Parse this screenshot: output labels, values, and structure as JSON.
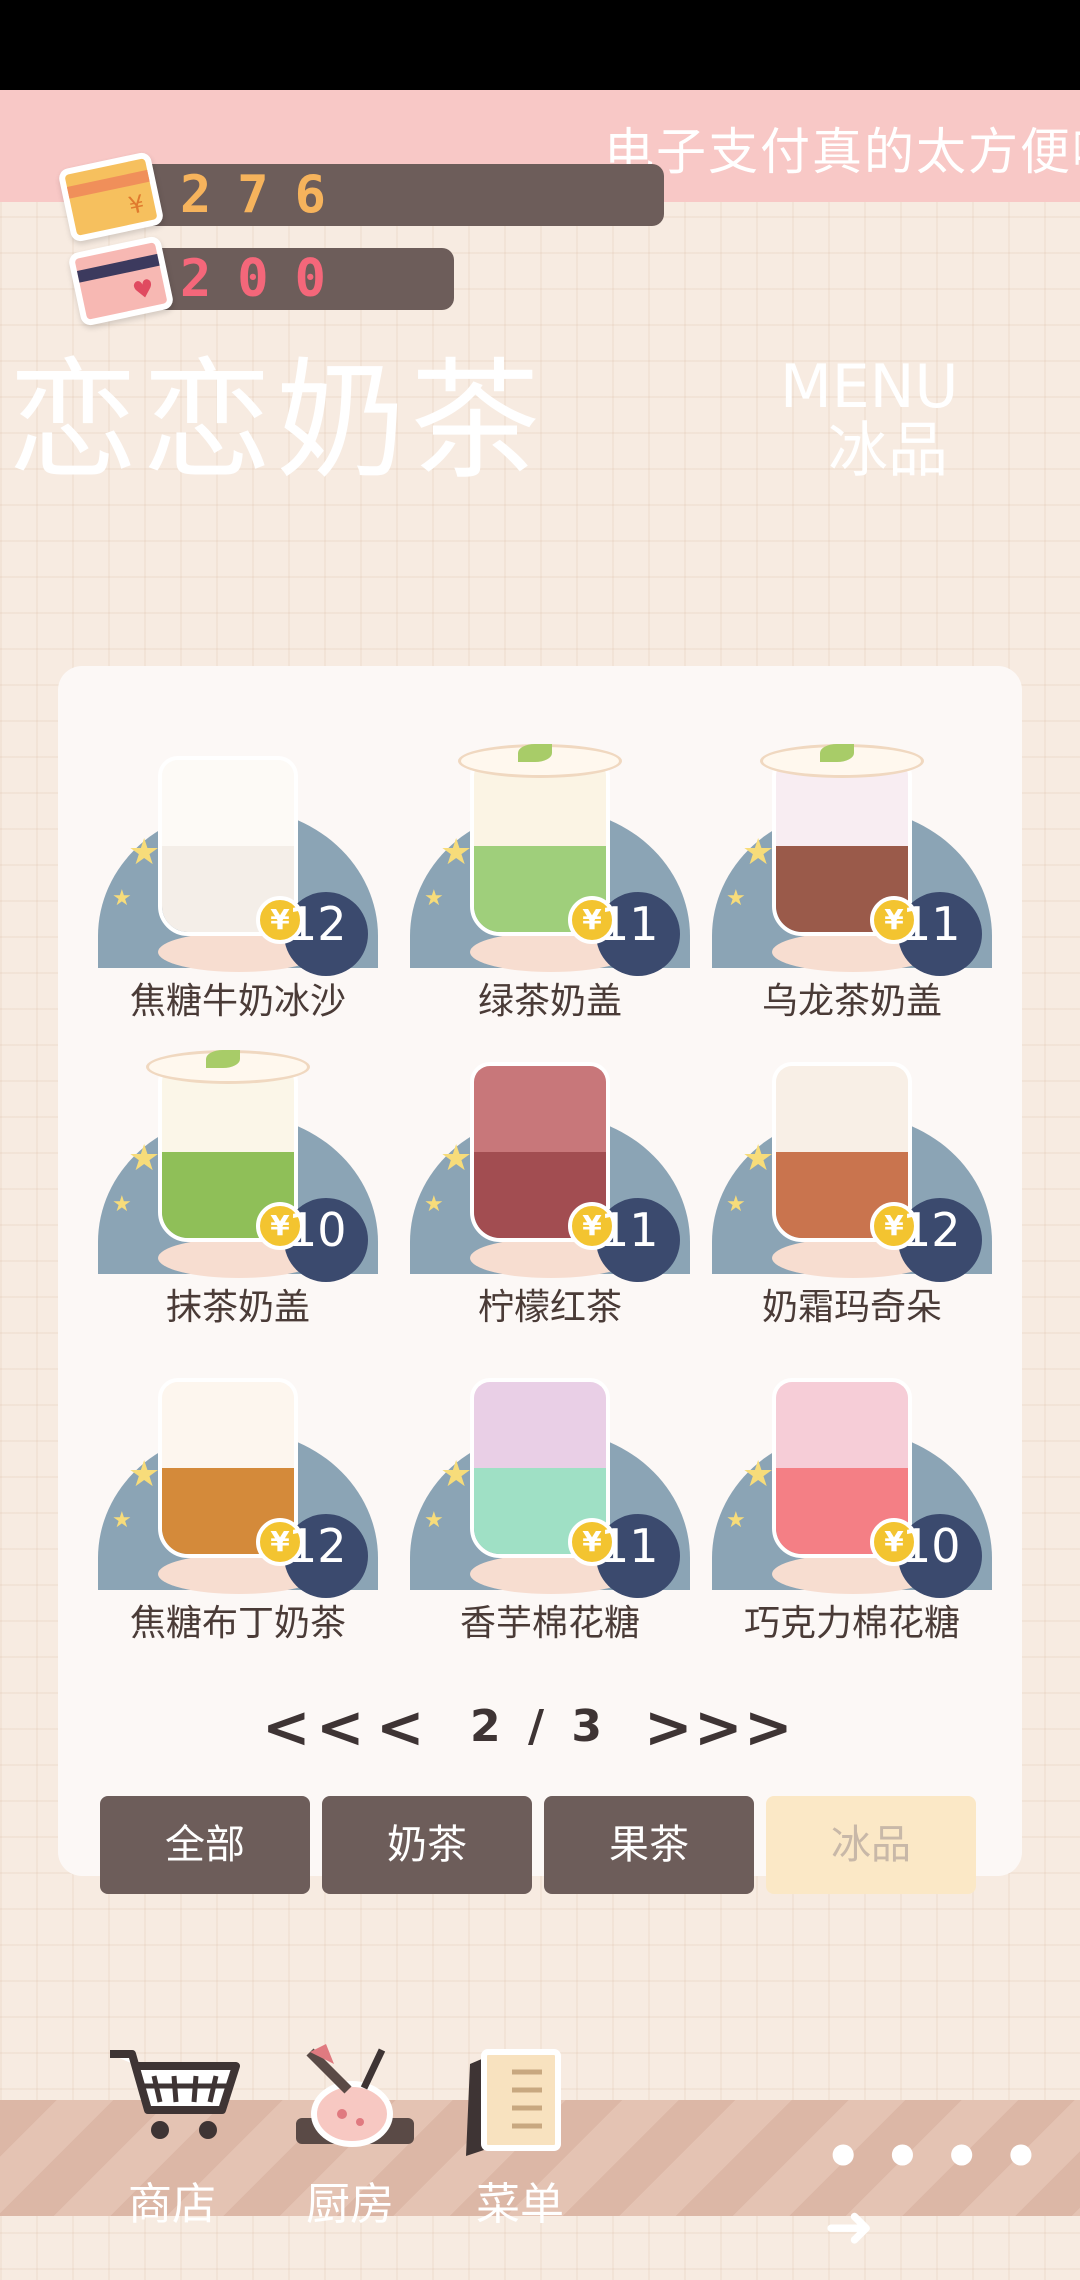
{
  "marquee": {
    "text": "电子支付真的太方便啦"
  },
  "wallet": {
    "money": "276",
    "hearts": "200"
  },
  "shop": {
    "title": "恋恋奶茶",
    "menu_label": "MENU",
    "category": "冰品"
  },
  "items": [
    {
      "name": "焦糖牛奶冰沙",
      "price": "12",
      "top": "#fdfaf6",
      "bottom": "#f4eee8",
      "lid": false
    },
    {
      "name": "绿茶奶盖",
      "price": "11",
      "top": "#fbf4e4",
      "bottom": "#9fcf7b",
      "lid": true
    },
    {
      "name": "乌龙茶奶盖",
      "price": "11",
      "top": "#f8edf2",
      "bottom": "#9a5a4a",
      "lid": true
    },
    {
      "name": "抹茶奶盖",
      "price": "10",
      "top": "#fbf6e8",
      "bottom": "#8fbf58",
      "lid": true
    },
    {
      "name": "柠檬红茶",
      "price": "11",
      "top": "#c8777a",
      "bottom": "#a24d51",
      "lid": false
    },
    {
      "name": "奶霜玛奇朵",
      "price": "12",
      "top": "#f8efe6",
      "bottom": "#c9744e",
      "lid": false
    },
    {
      "name": "焦糖布丁奶茶",
      "price": "12",
      "top": "#fdf6ee",
      "bottom": "#d48a3a",
      "lid": false
    },
    {
      "name": "香芋棉花糖",
      "price": "11",
      "top": "#e9cfe6",
      "bottom": "#9fe0c5",
      "lid": false
    },
    {
      "name": "巧克力棉花糖",
      "price": "10",
      "top": "#f6cdd7",
      "bottom": "#f47f85",
      "lid": false
    }
  ],
  "pager": {
    "current": "2",
    "total": "3",
    "separator": "/"
  },
  "tabs": [
    {
      "label": "全部",
      "active": false
    },
    {
      "label": "奶茶",
      "active": false
    },
    {
      "label": "果茶",
      "active": false
    },
    {
      "label": "冰品",
      "active": true
    }
  ],
  "nav": [
    {
      "label": "商店",
      "icon": "cart-icon"
    },
    {
      "label": "厨房",
      "icon": "kitchen-pot-icon"
    },
    {
      "label": "菜单",
      "icon": "menu-book-icon"
    }
  ]
}
